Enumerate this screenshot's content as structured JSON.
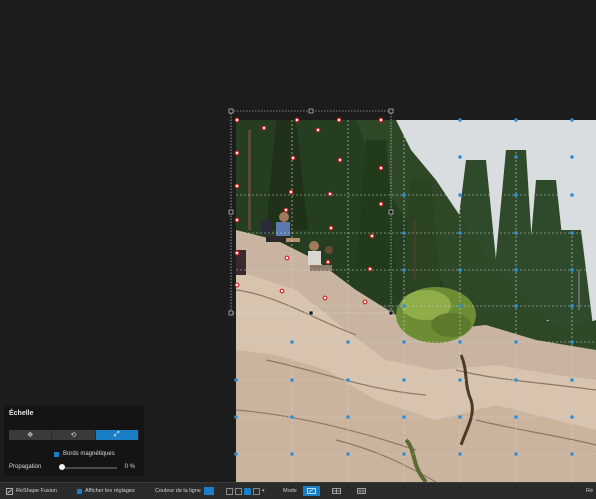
{
  "scale_panel": {
    "title": "Échelle",
    "mode_buttons": [
      {
        "name": "move",
        "icon": "move-icon",
        "glyph": "✥",
        "active": false
      },
      {
        "name": "rotate",
        "icon": "rotate-icon",
        "glyph": "⟲",
        "active": false
      },
      {
        "name": "scale",
        "icon": "scale-icon",
        "glyph": "⤢",
        "active": true
      }
    ],
    "magnetic_edges_label": "Bords magnétiques",
    "magnetic_edges_checked": true,
    "propagation_label": "Propagation",
    "propagation_value": "0 %",
    "propagation_level": 0
  },
  "toolbar": {
    "app_title": "ReShape Fusion",
    "show_settings_label": "Afficher les réglages",
    "line_color_label": "Couleur de la ligne",
    "line_color": "#1a7fc7",
    "mode_label": "Mode",
    "right_label": "Ré"
  },
  "colors": {
    "accent": "#1a7fc7",
    "panel": "#141414",
    "background": "#1c1c1c",
    "control_point": "#d62828",
    "grid_point": "#2f8fd6"
  }
}
